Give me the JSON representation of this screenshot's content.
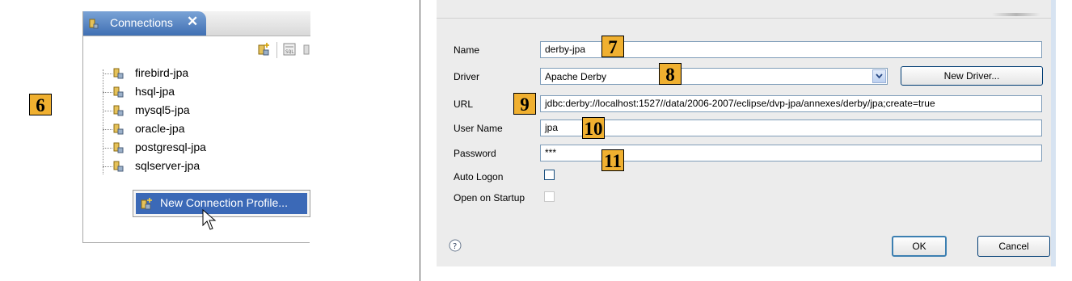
{
  "markers": {
    "m6": "6",
    "m7": "7",
    "m8": "8",
    "m9": "9",
    "m10": "10",
    "m11": "11"
  },
  "connections_view": {
    "tab_title": "Connections",
    "tab_close": "✕",
    "tab_icon": "database-connection-icon",
    "toolbar_icons": [
      "new-connection-icon",
      "sql-editor-icon"
    ],
    "profiles": [
      {
        "label": "firebird-jpa",
        "icon": "database-connection-icon"
      },
      {
        "label": "hsql-jpa",
        "icon": "database-connection-icon"
      },
      {
        "label": "mysql5-jpa",
        "icon": "database-connection-icon"
      },
      {
        "label": "oracle-jpa",
        "icon": "database-connection-icon"
      },
      {
        "label": "postgresql-jpa",
        "icon": "database-connection-icon"
      },
      {
        "label": "sqlserver-jpa",
        "icon": "database-connection-icon"
      }
    ],
    "context_menu": {
      "item_label": "New Connection Profile...",
      "item_icon": "new-connection-icon"
    }
  },
  "dialog": {
    "labels": {
      "name": "Name",
      "driver": "Driver",
      "url": "URL",
      "user_name": "User Name",
      "password": "Password",
      "auto_logon": "Auto Logon",
      "open_on_startup": "Open on Startup"
    },
    "values": {
      "name": "derby-jpa",
      "driver": "Apache Derby",
      "url": "jdbc:derby://localhost:1527//data/2006-2007/eclipse/dvp-jpa/annexes/derby/jpa;create=true",
      "user_name": "jpa",
      "password": "***"
    },
    "checkboxes": {
      "auto_logon": false,
      "open_on_startup": false
    },
    "buttons": {
      "new_driver": "New Driver...",
      "ok": "OK",
      "cancel": "Cancel"
    },
    "help_icon": "help-icon"
  },
  "colors": {
    "marker_bg": "#f0b030",
    "tab_active": "#3f6fb3",
    "menu_highlight": "#3b69b7",
    "dialog_bg": "#ececec"
  }
}
